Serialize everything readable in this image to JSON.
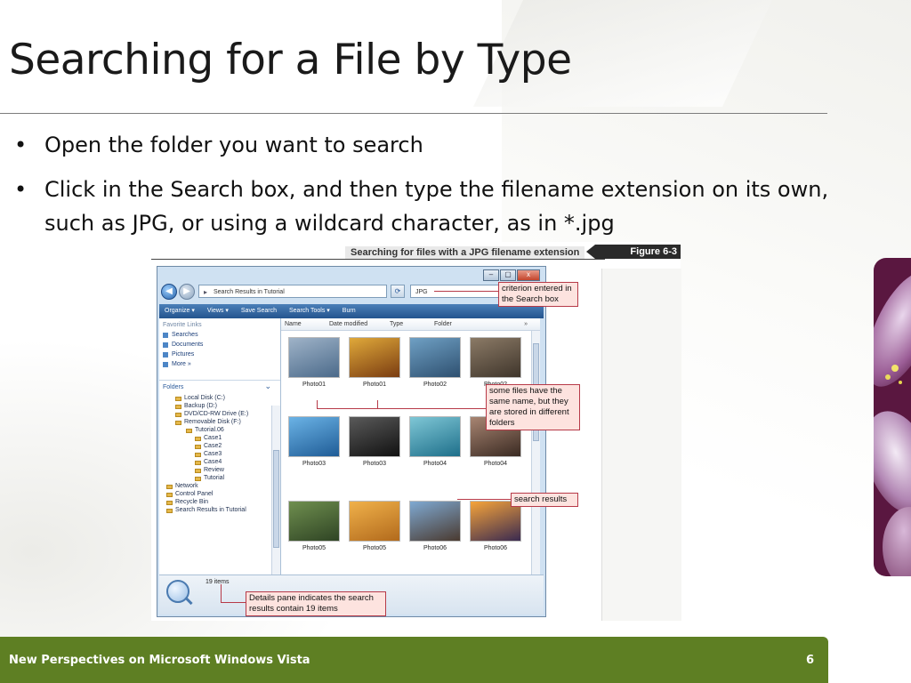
{
  "slide": {
    "title": "Searching for a File by Type",
    "bullets": [
      "Open the folder you want to search",
      "Click in the Search box, and then type the filename extension on its own, such as JPG, or using a wildcard character, as in *.jpg"
    ],
    "footer_title": "New Perspectives on Microsoft Windows Vista",
    "page_number": "6"
  },
  "figure": {
    "caption": "Searching for files with a JPG filename extension",
    "number": "Figure 6-3",
    "window": {
      "window_controls": [
        "–",
        "▢",
        "x"
      ],
      "back_glyph": "◀",
      "forward_glyph": "▶",
      "address": "Search Results in Tutorial",
      "refresh_glyph": "⟳",
      "search_value": "JPG",
      "toolbar": [
        "Organize ▾",
        "Views ▾",
        "Save Search",
        "Search Tools ▾",
        "Burn"
      ],
      "favorite_links_header": "Favorite Links",
      "favorite_links": [
        "Searches",
        "Documents",
        "Pictures"
      ],
      "more_link": "More »",
      "folders_header": "Folders",
      "folder_tree": [
        {
          "label": "Local Disk (C:)",
          "depth": 1
        },
        {
          "label": "Backup (D:)",
          "depth": 1
        },
        {
          "label": "DVD/CD-RW Drive (E:)",
          "depth": 1
        },
        {
          "label": "Removable Disk (F:)",
          "depth": 1
        },
        {
          "label": "Tutorial.06",
          "depth": 2
        },
        {
          "label": "Case1",
          "depth": 3
        },
        {
          "label": "Case2",
          "depth": 3
        },
        {
          "label": "Case3",
          "depth": 3
        },
        {
          "label": "Case4",
          "depth": 3
        },
        {
          "label": "Review",
          "depth": 3
        },
        {
          "label": "Tutorial",
          "depth": 3
        },
        {
          "label": "Network",
          "depth": 0
        },
        {
          "label": "Control Panel",
          "depth": 0
        },
        {
          "label": "Recycle Bin",
          "depth": 0
        },
        {
          "label": "Search Results in Tutorial",
          "depth": 0
        }
      ],
      "columns": [
        "Name",
        "Date modified",
        "Type",
        "Folder"
      ],
      "column_expand": "»",
      "files": [
        {
          "name": "Photo01",
          "colors": [
            "#9fb3c8",
            "#4b6a8a"
          ]
        },
        {
          "name": "Photo01",
          "colors": [
            "#e0a93a",
            "#7a3c11"
          ]
        },
        {
          "name": "Photo02",
          "colors": [
            "#6fa0c4",
            "#2e5070"
          ]
        },
        {
          "name": "Photo02",
          "colors": [
            "#8b7a66",
            "#3f352b"
          ]
        },
        {
          "name": "Photo03",
          "colors": [
            "#6bb3e6",
            "#1f5c96"
          ]
        },
        {
          "name": "Photo03",
          "colors": [
            "#5a5a5a",
            "#111111"
          ]
        },
        {
          "name": "Photo04",
          "colors": [
            "#7fc7d6",
            "#1e6f8a"
          ]
        },
        {
          "name": "Photo04",
          "colors": [
            "#a88572",
            "#3a2a22"
          ]
        },
        {
          "name": "Photo05",
          "colors": [
            "#6f8f4f",
            "#2f4424"
          ]
        },
        {
          "name": "Photo05",
          "colors": [
            "#f0b14a",
            "#b26a1c"
          ]
        },
        {
          "name": "Photo06",
          "colors": [
            "#7fa9d2",
            "#4a3a30"
          ]
        },
        {
          "name": "Photo06",
          "colors": [
            "#f6a43a",
            "#3a2a50"
          ]
        }
      ],
      "items_count": "19 items"
    },
    "callouts": [
      "criterion entered in the Search box",
      "some files have the same name, but they are stored in different folders",
      "search results",
      "Details pane indicates the search results contain 19 items"
    ]
  },
  "colors": {
    "footer": "#5e7f23",
    "callout_border": "#b73a48",
    "callout_fill": "#fde3df"
  }
}
